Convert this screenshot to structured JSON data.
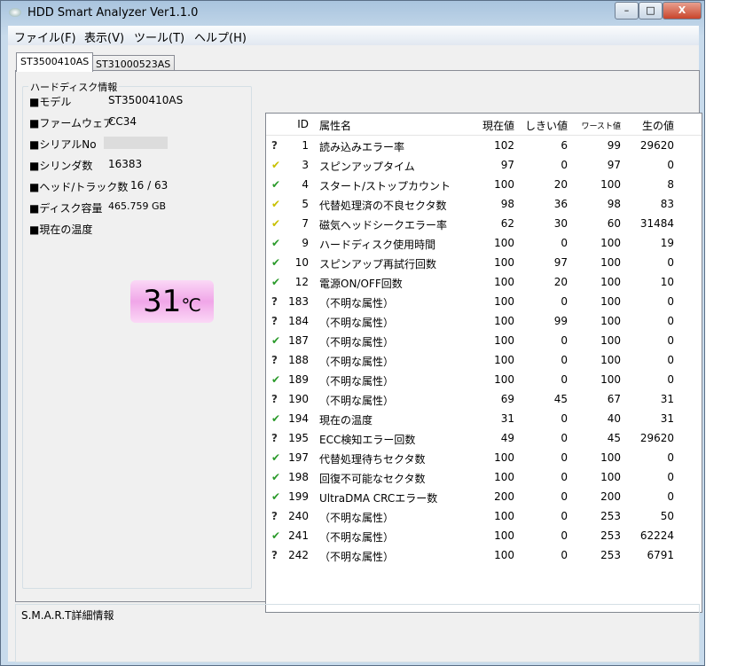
{
  "window": {
    "title": "HDD Smart Analyzer Ver1.1.0",
    "minimize": "–",
    "maximize": "□",
    "close": "X"
  },
  "menu": [
    "ファイル(F)",
    "表示(V)",
    "ツール(T)",
    "ヘルプ(H)"
  ],
  "tabs": [
    "ST3500410AS",
    "ST31000523AS"
  ],
  "info": {
    "caption": "ハードディスク情報",
    "fields": [
      {
        "label": "■モデル",
        "value": "ST3500410AS"
      },
      {
        "label": "■ファームウェア",
        "value": "CC34"
      },
      {
        "label": "■シリアルNo",
        "value": ""
      },
      {
        "label": "■シリンダ数",
        "value": "16383"
      },
      {
        "label": "■ヘッド/トラック数",
        "value": "16  /  63"
      },
      {
        "label": "■ディスク容量",
        "value": "465.759 GB"
      },
      {
        "label": "■現在の温度",
        "value": ""
      }
    ],
    "temperature": "31",
    "temperature_unit": "℃"
  },
  "table": {
    "columns": [
      "ID",
      "属性名",
      "現在値",
      "しきい値",
      "ワースト値",
      "生の値"
    ],
    "status_colors": {
      "unknown": "#333333",
      "warn": "#c8c000",
      "ok": "#2a9a2a"
    },
    "rows": [
      {
        "status": "unknown",
        "id": "1",
        "name": "読み込みエラー率",
        "cur": "102",
        "thr": "6",
        "worst": "99",
        "raw": "29620"
      },
      {
        "status": "warn",
        "id": "3",
        "name": "スピンアップタイム",
        "cur": "97",
        "thr": "0",
        "worst": "97",
        "raw": "0"
      },
      {
        "status": "ok",
        "id": "4",
        "name": "スタート/ストップカウント",
        "cur": "100",
        "thr": "20",
        "worst": "100",
        "raw": "8"
      },
      {
        "status": "warn",
        "id": "5",
        "name": "代替処理済の不良セクタ数",
        "cur": "98",
        "thr": "36",
        "worst": "98",
        "raw": "83"
      },
      {
        "status": "warn",
        "id": "7",
        "name": "磁気ヘッドシークエラー率",
        "cur": "62",
        "thr": "30",
        "worst": "60",
        "raw": "31484"
      },
      {
        "status": "ok",
        "id": "9",
        "name": "ハードディスク使用時間",
        "cur": "100",
        "thr": "0",
        "worst": "100",
        "raw": "19"
      },
      {
        "status": "ok",
        "id": "10",
        "name": "スピンアップ再試行回数",
        "cur": "100",
        "thr": "97",
        "worst": "100",
        "raw": "0"
      },
      {
        "status": "ok",
        "id": "12",
        "name": "電源ON/OFF回数",
        "cur": "100",
        "thr": "20",
        "worst": "100",
        "raw": "10"
      },
      {
        "status": "unknown",
        "id": "183",
        "name": "（不明な属性）",
        "cur": "100",
        "thr": "0",
        "worst": "100",
        "raw": "0"
      },
      {
        "status": "unknown",
        "id": "184",
        "name": "（不明な属性）",
        "cur": "100",
        "thr": "99",
        "worst": "100",
        "raw": "0"
      },
      {
        "status": "ok",
        "id": "187",
        "name": "（不明な属性）",
        "cur": "100",
        "thr": "0",
        "worst": "100",
        "raw": "0"
      },
      {
        "status": "unknown",
        "id": "188",
        "name": "（不明な属性）",
        "cur": "100",
        "thr": "0",
        "worst": "100",
        "raw": "0"
      },
      {
        "status": "ok",
        "id": "189",
        "name": "（不明な属性）",
        "cur": "100",
        "thr": "0",
        "worst": "100",
        "raw": "0"
      },
      {
        "status": "unknown",
        "id": "190",
        "name": "（不明な属性）",
        "cur": "69",
        "thr": "45",
        "worst": "67",
        "raw": "31"
      },
      {
        "status": "ok",
        "id": "194",
        "name": "現在の温度",
        "cur": "31",
        "thr": "0",
        "worst": "40",
        "raw": "31"
      },
      {
        "status": "unknown",
        "id": "195",
        "name": "ECC検知エラー回数",
        "cur": "49",
        "thr": "0",
        "worst": "45",
        "raw": "29620"
      },
      {
        "status": "ok",
        "id": "197",
        "name": "代替処理待ちセクタ数",
        "cur": "100",
        "thr": "0",
        "worst": "100",
        "raw": "0"
      },
      {
        "status": "ok",
        "id": "198",
        "name": "回復不可能なセクタ数",
        "cur": "100",
        "thr": "0",
        "worst": "100",
        "raw": "0"
      },
      {
        "status": "ok",
        "id": "199",
        "name": "UltraDMA CRCエラー数",
        "cur": "200",
        "thr": "0",
        "worst": "200",
        "raw": "0"
      },
      {
        "status": "unknown",
        "id": "240",
        "name": "（不明な属性）",
        "cur": "100",
        "thr": "0",
        "worst": "253",
        "raw": "50"
      },
      {
        "status": "ok",
        "id": "241",
        "name": "（不明な属性）",
        "cur": "100",
        "thr": "0",
        "worst": "253",
        "raw": "62224"
      },
      {
        "status": "unknown",
        "id": "242",
        "name": "（不明な属性）",
        "cur": "100",
        "thr": "0",
        "worst": "253",
        "raw": "6791"
      }
    ]
  },
  "details": {
    "caption": "S.M.A.R.T詳細情報"
  }
}
